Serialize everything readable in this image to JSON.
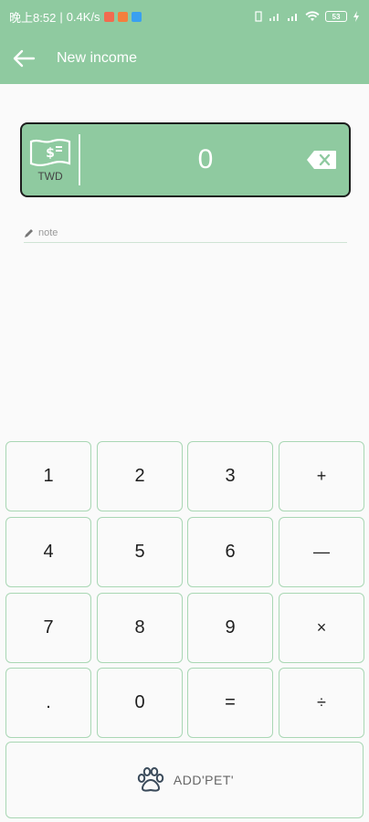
{
  "status_bar": {
    "time": "晚上8:52",
    "speed": "0.4K/s",
    "notification_colors": [
      "#f26b4f",
      "#f47f3d",
      "#3aa0f0"
    ],
    "battery": "53"
  },
  "header": {
    "title": "New income",
    "back_icon": "arrow-left-icon"
  },
  "amount_card": {
    "currency_code": "TWD",
    "currency_icon": "banknote-icon",
    "amount": "0",
    "backspace_icon": "backspace-icon"
  },
  "note": {
    "placeholder": "note",
    "value": "",
    "icon": "pencil-icon"
  },
  "keypad": {
    "keys": [
      {
        "label": "1"
      },
      {
        "label": "2"
      },
      {
        "label": "3"
      },
      {
        "label": "+"
      },
      {
        "label": "4"
      },
      {
        "label": "5"
      },
      {
        "label": "6"
      },
      {
        "label": "—"
      },
      {
        "label": "7"
      },
      {
        "label": "8"
      },
      {
        "label": "9"
      },
      {
        "label": "×"
      },
      {
        "label": "."
      },
      {
        "label": "0"
      },
      {
        "label": "="
      },
      {
        "label": "÷"
      }
    ]
  },
  "add_button": {
    "label": "ADD'PET'",
    "icon": "paw-icon"
  },
  "colors": {
    "accent": "#8fcaa0",
    "key_border": "#a9d7b4"
  }
}
